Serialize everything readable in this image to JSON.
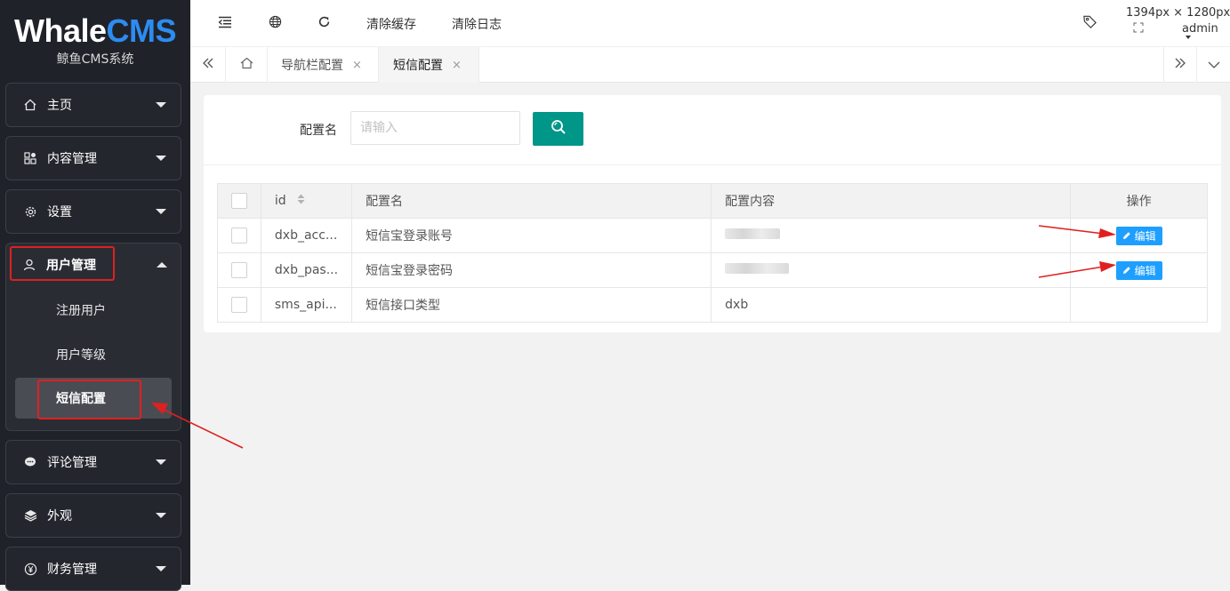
{
  "app": {
    "logo_main_a": "Whale",
    "logo_main_b": "CMS",
    "logo_sub": "鲸鱼CMS系统",
    "accent_color": "#2d8cf0"
  },
  "sidebar": {
    "items": [
      {
        "label": "主页",
        "icon": "home-icon"
      },
      {
        "label": "内容管理",
        "icon": "grid-icon"
      },
      {
        "label": "设置",
        "icon": "gear-icon"
      },
      {
        "label": "用户管理",
        "icon": "user-icon",
        "expanded": true,
        "children": [
          {
            "label": "注册用户"
          },
          {
            "label": "用户等级"
          },
          {
            "label": "短信配置",
            "active": true
          }
        ]
      },
      {
        "label": "评论管理",
        "icon": "comment-icon"
      },
      {
        "label": "外观",
        "icon": "layers-icon"
      },
      {
        "label": "财务管理",
        "icon": "yen-icon"
      }
    ]
  },
  "header": {
    "clear_cache": "清除缓存",
    "clear_log": "清除日志",
    "size_readout": "1394px × 1280px",
    "user": "admin"
  },
  "tabs": [
    {
      "label": "导航栏配置",
      "close": "×"
    },
    {
      "label": "短信配置",
      "close": "×",
      "active": true
    }
  ],
  "search": {
    "label": "配置名",
    "placeholder": "请输入"
  },
  "table": {
    "columns": [
      "id",
      "配置名",
      "配置内容",
      "操作"
    ],
    "rows": [
      {
        "id": "dxb_acc...",
        "name": "短信宝登录账号",
        "content": "",
        "action": "编辑"
      },
      {
        "id": "dxb_pas...",
        "name": "短信宝登录密码",
        "content": "",
        "action": "编辑"
      },
      {
        "id": "sms_api...",
        "name": "短信接口类型",
        "content": "dxb",
        "action": ""
      }
    ]
  },
  "colors": {
    "sidebar_bg": "#20222a",
    "primary_green": "#009688",
    "edit_blue": "#1e9fff",
    "annotation_red": "#e02020"
  }
}
